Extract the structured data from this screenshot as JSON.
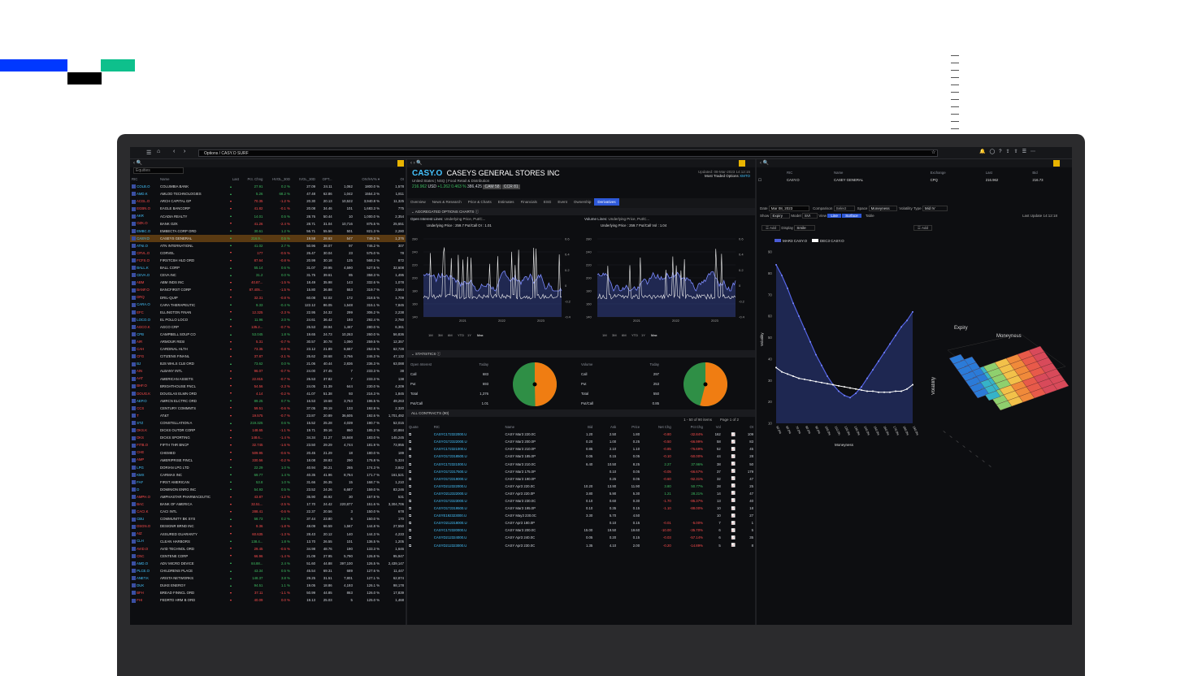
{
  "app": {
    "address": "Options / CASY.O SURF"
  },
  "left": {
    "filter_label": "Equities",
    "headers": [
      "RIC",
      "Name",
      "Last",
      "Pct. Chng",
      "HVOL_30D",
      "IVOL_30D",
      "OPT...",
      "",
      "OIV/HV% ▾",
      "OI"
    ],
    "rows": [
      [
        "COLB.O",
        "COLUMBIA BANK",
        "27.91",
        "0.2 %",
        "27.09",
        "24.11",
        "1,062",
        "1800.0 %",
        "1,578",
        "u"
      ],
      [
        "AMD.K",
        "AMLOD TECHNOLOGIES",
        "5.26",
        "68.2 %",
        "47.48",
        "62.86",
        "1,042",
        "1554.3 %",
        "1,811",
        "u"
      ],
      [
        "ACGL.O",
        "ARCH CAPITAL GP",
        "70.35",
        "-1.2 %",
        "20.30",
        "20.13",
        "10,522",
        "3,940.8 %",
        "11,325",
        "d"
      ],
      [
        "EGBN.O",
        "EAGLE BANCORP",
        "41.82",
        "-0.1 %",
        "20.08",
        "34.46",
        "101",
        "1,683.3 %",
        "775",
        "d"
      ],
      [
        "AKR",
        "ACADIA REALTY",
        "14.01",
        "0.5 %",
        "28.76",
        "50.44",
        "10",
        "1,000.0 %",
        "2,354",
        "u"
      ],
      [
        "OZK.O",
        "BANK OZK",
        "41.26",
        "-2.4 %",
        "28.71",
        "31.04",
        "10,716",
        "875.5 %",
        "25,651",
        "d"
      ],
      [
        "EMBC.O",
        "EMBECTA CORP ORD",
        "30.61",
        "1.2 %",
        "56.71",
        "55.56",
        "501",
        "821.3 %",
        "2,280",
        "u"
      ],
      [
        "CASY.O",
        "CASEYS GENERAL",
        "216.9...",
        "0.5 %",
        "19.58",
        "28.63",
        "547",
        "749.3 %",
        "1,376",
        "u"
      ],
      [
        "ATNI.O",
        "ATN INTERNATIONL",
        "41.02",
        "2.7 %",
        "50.96",
        "38.07",
        "97",
        "746.2 %",
        "307",
        "u"
      ],
      [
        "CRVL.O",
        "CORVEL",
        "177",
        "-0.5 %",
        "26.47",
        "30.04",
        "23",
        "575.0 %",
        "78",
        "d"
      ],
      [
        "FCFS.O",
        "FIRSTCSH HLD ORD",
        "87.64",
        "-0.8 %",
        "20.99",
        "30.18",
        "125",
        "568.2 %",
        "872",
        "d"
      ],
      [
        "BALL.K",
        "BALL CORP",
        "55.14",
        "0.6 %",
        "31.07",
        "29.95",
        "4,590",
        "527.5 %",
        "32,608",
        "u"
      ],
      [
        "CEVA.O",
        "CEVA INC",
        "31.2",
        "0.0 %",
        "31.75",
        "39.61",
        "85",
        "358.3 %",
        "1,495",
        "u"
      ],
      [
        "ABM",
        "ABM INDS INC",
        "40.87...",
        "-1.5 %",
        "18.49",
        "35.98",
        "143",
        "332.6 %",
        "1,078",
        "d"
      ],
      [
        "BANF.O",
        "BANCFIRST CORP",
        "87.405...",
        "-1.5 %",
        "15.80",
        "36.88",
        "553",
        "319.7 %",
        "3,564",
        "d"
      ],
      [
        "DRQ",
        "DRIL-QUIP",
        "32.31",
        "-0.8 %",
        "60.08",
        "52.02",
        "172",
        "318.5 %",
        "1,709",
        "d"
      ],
      [
        "CARA.O",
        "CARA THERAPEUTIC",
        "9.33",
        "-0.4 %",
        "122.12",
        "86.05",
        "1,548",
        "315.1 %",
        "7,845",
        "u"
      ],
      [
        "EFC",
        "ELLINGTON FINAN",
        "12.325",
        "-2.3 %",
        "22.95",
        "24.32",
        "299",
        "306.2 %",
        "2,238",
        "d"
      ],
      [
        "LOCO.O",
        "EL POLLO LOCO",
        "11.96",
        "2.0 %",
        "24.61",
        "36.42",
        "193",
        "292.4 %",
        "2,760",
        "u"
      ],
      [
        "AGCO.K",
        "AGCO CRP",
        "135.2...",
        "-0.7 %",
        "25.53",
        "28.94",
        "1,467",
        "280.0 %",
        "6,361",
        "d"
      ],
      [
        "CPB",
        "CAMPBELL SOUP CO",
        "53.045",
        "1.8 %",
        "19.65",
        "24.73",
        "10,263",
        "260.0 %",
        "56,836",
        "u"
      ],
      [
        "AIR",
        "ARMOUR RESI",
        "5.31",
        "-0.7 %",
        "30.57",
        "30.78",
        "1,090",
        "259.5 %",
        "12,357",
        "d"
      ],
      [
        "CAH",
        "CARDINAL HLTH",
        "73.35",
        "-0.8 %",
        "23.12",
        "21.89",
        "6,657",
        "252.6 %",
        "62,728",
        "d"
      ],
      [
        "CFG",
        "CITIZENS FINANL",
        "37.87",
        "-2.1 %",
        "25.62",
        "28.68",
        "3,766",
        "246.3 %",
        "47,132",
        "d"
      ],
      [
        "BJ",
        "BJS WHLS CLB ORD",
        "73.62",
        "0.0 %",
        "21.06",
        "40.44",
        "2,836",
        "236.3 %",
        "63,088",
        "u"
      ],
      [
        "AIN",
        "ALBANY INTL",
        "96.07",
        "-0.7 %",
        "24.00",
        "27.45",
        "7",
        "233.3 %",
        "38",
        "d"
      ],
      [
        "AAT",
        "AMERICAN ASSETS",
        "22.815",
        "-0.7 %",
        "25.53",
        "37.82",
        "7",
        "233.3 %",
        "138",
        "d"
      ],
      [
        "BHF.O",
        "BRIGHTHOUSE FNCL",
        "54.56",
        "-2.3 %",
        "24.05",
        "31.39",
        "644",
        "230.0 %",
        "4,209",
        "d"
      ],
      [
        "DOUG.K",
        "DOUGLAS ELMN ORD",
        "4.14",
        "-0.2 %",
        "41.07",
        "51.38",
        "93",
        "216.3 %",
        "1,845",
        "d"
      ],
      [
        "AEP.O",
        "AMRCN ELCTRC ORD",
        "89.25",
        "0.7 %",
        "16.53",
        "19.68",
        "3,763",
        "196.5 %",
        "49,263",
        "u"
      ],
      [
        "CCS",
        "CENTURY COMMNTS",
        "59.51",
        "-0.6 %",
        "37.05",
        "39.19",
        "133",
        "192.8 %",
        "2,320",
        "d"
      ],
      [
        "T",
        "AT&T",
        "19.575",
        "-0.7 %",
        "23.87",
        "20.89",
        "36,605",
        "192.6 %",
        "1,701,492",
        "d"
      ],
      [
        "STZ",
        "CONSTELLATION A",
        "219.325",
        "0.6 %",
        "15.52",
        "25.28",
        "4,039",
        "190.7 %",
        "52,015",
        "u"
      ],
      [
        "DKS.K",
        "DICKS OUTDR CORP",
        "148.65",
        "-1.1 %",
        "19.71",
        "39.16",
        "860",
        "185.2 %",
        "10,884",
        "d"
      ],
      [
        "DKS",
        "DICKS SPORTING",
        "148.6...",
        "-1.4 %",
        "34.34",
        "31.27",
        "15,848",
        "183.0 %",
        "145,245",
        "d"
      ],
      [
        "FITB.O",
        "FIFTH THR BNCP",
        "32.745",
        "-1.6 %",
        "23.50",
        "29.29",
        "4,744",
        "181.9 %",
        "73,955",
        "d"
      ],
      [
        "CHE",
        "CHEMED",
        "509.95",
        "-0.6 %",
        "20.45",
        "21.29",
        "18",
        "180.0 %",
        "189",
        "d"
      ],
      [
        "AMP",
        "AMERIPRISE FINCL",
        "330.56",
        "-0.2 %",
        "18.08",
        "28.83",
        "290",
        "176.8 %",
        "5,324",
        "d"
      ],
      [
        "LPG",
        "DORIAN LPG LTD",
        "22.29",
        "1.0 %",
        "40.94",
        "36.21",
        "265",
        "174.3 %",
        "3,842",
        "u"
      ],
      [
        "KMX",
        "CARMAX INC",
        "69.77",
        "1.4 %",
        "40.35",
        "41.96",
        "8,764",
        "171.7 %",
        "161,521",
        "u"
      ],
      [
        "FAF",
        "FIRST AMERICAN",
        "53.8",
        "1.0 %",
        "31.66",
        "26.35",
        "15",
        "168.7 %",
        "1,210",
        "u"
      ],
      [
        "D",
        "DOMINION ENRG INC",
        "54.93",
        "0.5 %",
        "23.52",
        "24.26",
        "6,687",
        "159.0 %",
        "83,246",
        "u"
      ],
      [
        "AMPH.O",
        "AMPHASTAR PHARMACEUTIC",
        "43.87",
        "-1.2 %",
        "35.90",
        "46.92",
        "30",
        "157.9 %",
        "531",
        "d"
      ],
      [
        "BAC",
        "BANK OF AMERICA",
        "32.51...",
        "-2.5 %",
        "17.70",
        "24.42",
        "220,877",
        "151.6 %",
        "3,304,706",
        "d"
      ],
      [
        "CACI.K",
        "CACI INTL",
        "288.41",
        "-0.6 %",
        "22.37",
        "20.56",
        "3",
        "150.0 %",
        "678",
        "d"
      ],
      [
        "CBU",
        "COMMUNITY BK SYS",
        "58.73",
        "0.2 %",
        "37.44",
        "23.80",
        "6",
        "150.0 %",
        "170",
        "u"
      ],
      [
        "DSGN.O",
        "DESIGNR BRND INC",
        "9.36",
        "-1.8 %",
        "48.09",
        "66.59",
        "1,567",
        "144.8 %",
        "27,550",
        "d"
      ],
      [
        "AIZ",
        "ASSURED GUARANTY",
        "60.635",
        "-1.3 %",
        "28.43",
        "20.12",
        "140",
        "144.3 %",
        "4,233",
        "d"
      ],
      [
        "CLH",
        "CLEAN HARBORS",
        "138.4...",
        "1.8 %",
        "13.70",
        "26.55",
        "101",
        "136.5 %",
        "1,205",
        "u"
      ],
      [
        "AVID.O",
        "AVID TECHNOL ORD",
        "29.45",
        "-0.5 %",
        "34.98",
        "48.76",
        "190",
        "133.3 %",
        "1,646",
        "d"
      ],
      [
        "CNC",
        "CENTENE CORP",
        "66.96",
        "-1.4 %",
        "21.09",
        "27.95",
        "5,790",
        "126.8 %",
        "95,947",
        "d"
      ],
      [
        "AMD.O",
        "ADV MICRO DEVICE",
        "84.88...",
        "2.4 %",
        "51.60",
        "44.88",
        "397,100",
        "126.5 %",
        "2,439,147",
        "u"
      ],
      [
        "PLCE.O",
        "CHILDRENS PLACE",
        "43.34",
        "0.5 %",
        "45.54",
        "69.31",
        "689",
        "127.6 %",
        "11,447",
        "u"
      ],
      [
        "ANET.K",
        "ARISTA NETWORKS",
        "148.37",
        "3.8 %",
        "29.25",
        "31.51",
        "7,801",
        "127.1 %",
        "62,874",
        "u"
      ],
      [
        "DUK",
        "DUKE ENERGY",
        "94.51",
        "1.1 %",
        "19.05",
        "18.86",
        "4,193",
        "126.1 %",
        "98,178",
        "u"
      ],
      [
        "BFH",
        "BREAD FINNCL ORD",
        "37.11",
        "-1.1 %",
        "50.99",
        "44.85",
        "863",
        "126.0 %",
        "17,839",
        "d"
      ],
      [
        "FHI",
        "FEDRTD HRM B ORD",
        "40.09",
        "0.0 %",
        "19.13",
        "25.03",
        "5",
        "125.0 %",
        "1,468",
        "d"
      ]
    ]
  },
  "mid": {
    "ticker": "CASY.O",
    "company": "CASEYS GENERAL STORES INC",
    "meta": "United States | NSQ | Food Retail & Distribution",
    "updated": "Updated: 08-Mar-2023 14:12:15",
    "most_traded": "Most Traded Options",
    "most_traded_link": "XMTO",
    "price": "216.962",
    "ccy": "USD",
    "chg": "+1.262",
    "pct": "0.463 %",
    "vol": "386,425",
    "badge1": "CAM 58",
    "badge2": "CCR 81",
    "tabs": [
      "Overview",
      "News & Research",
      "Price & Charts",
      "Estimates",
      "Financials",
      "ESG",
      "Event",
      "Ownership",
      "Derivatives"
    ],
    "agg_title": "AGGREGATED OPTIONS CHARTS",
    "oi_title": "Open Interest Lines:",
    "oi_sel": "Underlying Price, Put/C...",
    "oi_legend": "Underlying Price : 259.7   Put/Call OI : 1.01",
    "vol_title": "Volume Lines:",
    "vol_sel": "Underlying Price, Put/C...",
    "vol_legend": "Underlying Price : 259.7   Put/Call Vol : 1.04",
    "y_left": [
      "280",
      "240",
      "220",
      "200",
      "180",
      "160",
      "140"
    ],
    "y_right": [
      "0.6",
      "0.4",
      "0.2",
      "0",
      "-0.2",
      "-0.4"
    ],
    "years": [
      "2021",
      "2022",
      "2023"
    ],
    "ranges": [
      "1M",
      "3M",
      "6M",
      "YTD",
      "1Y",
      "Max"
    ],
    "stats_title": "STATISTICS",
    "oi_table": {
      "head": [
        "Open Interest",
        "Today"
      ],
      "rows": [
        [
          "Call",
          "683"
        ],
        [
          "Put",
          "693"
        ],
        [
          "Total",
          "1,376"
        ],
        [
          "Put/Call",
          "1.01"
        ]
      ]
    },
    "vol_table": {
      "head": [
        "Volume",
        "Today"
      ],
      "rows": [
        [
          "Call",
          "297"
        ],
        [
          "Put",
          "253"
        ],
        [
          "Total",
          "550"
        ],
        [
          "Put/Call",
          "0.85"
        ]
      ]
    },
    "contracts_title": "ALL CONTRACTS (90)",
    "pager": "1 - 50 of 90 items",
    "page": "Page 1 of 2",
    "c_head": [
      "Quote",
      "RIC",
      "Name",
      "Bid",
      "Ask",
      "Price",
      "Net Chg",
      "Pct Chg",
      "Vol",
      "",
      "OI"
    ],
    "contracts": [
      [
        "CASYC172322000.U",
        "CASY Mar3 220.0C",
        "1.20",
        "2.50",
        "1.80",
        "-0.80",
        "-32.84%",
        "162",
        "109"
      ],
      [
        "CASYO172322000.U",
        "CASY Mar3 200.0P",
        "0.20",
        "1.00",
        "0.25",
        "-0.50",
        "-66.99%",
        "58",
        "83"
      ],
      [
        "CASYC172321000.U",
        "CASY Mar3 210.0P",
        "0.85",
        "2.10",
        "1.10",
        "-0.85",
        "-76.69%",
        "52",
        "45"
      ],
      [
        "CASYO172318500.U",
        "CASY Mar3 185.0P",
        "0.05",
        "0.15",
        "0.05",
        "-0.10",
        "-50.00%",
        "44",
        "28"
      ],
      [
        "CASYC172321000.U",
        "CASY Mar3 210.0C",
        "6.40",
        "10.50",
        "8.25",
        "2.27",
        "37.96%",
        "38",
        "50"
      ],
      [
        "CASYO172317500.U",
        "CASY Mar3 175.0P",
        "",
        "0.10",
        "0.05",
        "-0.05",
        "-66.67%",
        "37",
        "179"
      ],
      [
        "CASYO172319000.U",
        "CASY Mar3 190.0P",
        "",
        "0.25",
        "0.05",
        "-0.60",
        "-92.31%",
        "32",
        "47"
      ],
      [
        "CASYD212322000.U",
        "CASY Apr3 220.0C",
        "10.20",
        "13.90",
        "11.90",
        "3.80",
        "50.77%",
        "28",
        "25"
      ],
      [
        "CASYO212322000.U",
        "CASY Apr3 220.0P",
        "3.80",
        "5.90",
        "5.30",
        "1.21",
        "28.21%",
        "14",
        "47"
      ],
      [
        "CASYO172323000.U",
        "CASY Mar3 230.0C",
        "0.10",
        "0.60",
        "0.30",
        "-1.70",
        "-85.37%",
        "13",
        "40"
      ],
      [
        "CASYO172319500.U",
        "CASY Mar3 195.0P",
        "0.10",
        "0.35",
        "0.15",
        "-1.10",
        "-88.00%",
        "10",
        "18"
      ],
      [
        "CASYE192323000.U",
        "CASY May3 230.0C",
        "3.30",
        "5.70",
        "4.50",
        "",
        "",
        "10",
        "27"
      ],
      [
        "CASYO212318000.U",
        "CASY Apr3 180.0P",
        "",
        "0.10",
        "0.15",
        "-0.01",
        "-5.00%",
        "7",
        "1"
      ],
      [
        "CASYC172320000.U",
        "CASY Mar3 200.0C",
        "15.00",
        "19.50",
        "19.60",
        "-10.00",
        "-35.70%",
        "6",
        "5"
      ],
      [
        "CASYD212324000.U",
        "CASY Apr3 240.0C",
        "0.05",
        "0.20",
        "0.15",
        "-0.03",
        "-57.14%",
        "6",
        "35"
      ],
      [
        "CASYD212323000.U",
        "CASY Apr3 230.0C",
        "1.35",
        "4.10",
        "2.00",
        "-0.20",
        "-14.89%",
        "5",
        "8"
      ]
    ]
  },
  "right": {
    "headers": [
      "RIC",
      "Name",
      "Exchange",
      "Last",
      "Bid"
    ],
    "row": [
      "CASY.O",
      "CASEY GENERAL",
      "CPQ",
      "216.962",
      "216.73"
    ],
    "date_label": "Date",
    "date": "Mar 08, 2023",
    "comparison": "Comparison",
    "comparison_val": "Select",
    "space": "Space",
    "space_val": "Moneyness",
    "vt": "Volatility Type",
    "vt_val": "Mid IV",
    "show": "Show",
    "show_val": "Expiry",
    "model": "Model",
    "model_val": "SVI",
    "view": "View",
    "btn_line": "Line",
    "btn_surface": "Surface",
    "btn_table": "Table",
    "last_update": "Last Update 14:12:18",
    "add": "Add",
    "display": "Display",
    "display_val": "Smile",
    "leg1": "MAR3 CASY.O",
    "leg2": "DEC3 CASY.O",
    "ylab": "Volatility",
    "xlab": "Moneyness",
    "surf_expiry": "Expiry",
    "surf_money": "Moneyness",
    "surf_vol": "Volatility",
    "yticks": [
      "90",
      "80",
      "70",
      "60",
      "50",
      "40",
      "30",
      "20",
      "10"
    ],
    "xticks": [
      "50.0%",
      "60.0%",
      "70.0%",
      "80.0%",
      "90.0%",
      "100.0%",
      "110.0%",
      "120.0%",
      "130.0%",
      "140.0%",
      "150.0%",
      "160.0%",
      "170.0%",
      "180.0%",
      "190.0%"
    ]
  },
  "chart_data": [
    {
      "type": "line",
      "title": "Smile",
      "xlabel": "Moneyness",
      "ylabel": "Volatility",
      "ylim": [
        10,
        90
      ],
      "x": [
        "50.0%",
        "55.0%",
        "60.0%",
        "65.0%",
        "70.0%",
        "75.0%",
        "80.0%",
        "85.0%",
        "90.0%",
        "95.0%",
        "100.0%",
        "105.0%",
        "110.0%",
        "115.0%",
        "120.0%",
        "125.0%",
        "130.0%",
        "135.0%",
        "140.0%",
        "145.0%",
        "150.0%",
        "155.0%",
        "160.0%",
        "165.0%",
        "170.0%"
      ],
      "series": [
        {
          "name": "MAR3 CASY.O",
          "values": [
            84,
            79,
            73,
            66,
            60,
            54,
            48,
            42,
            37,
            32,
            28,
            25,
            23,
            22,
            24,
            27,
            31,
            35,
            39,
            43,
            47,
            51,
            55,
            58,
            62
          ]
        },
        {
          "name": "DEC3 CASY.O",
          "values": [
            36,
            34,
            33,
            32,
            31,
            30.5,
            30,
            29.5,
            29,
            28.5,
            28,
            27.5,
            27,
            26.5,
            26,
            25.5,
            25,
            25,
            24.5,
            24.5,
            24.5,
            25,
            25,
            26,
            28
          ]
        }
      ]
    }
  ],
  "colors": {
    "accent": "#2e59d9",
    "up": "#3fbf62",
    "down": "#ff4d4d",
    "pie_green": "#2f8f46",
    "pie_orange": "#f07d12"
  }
}
